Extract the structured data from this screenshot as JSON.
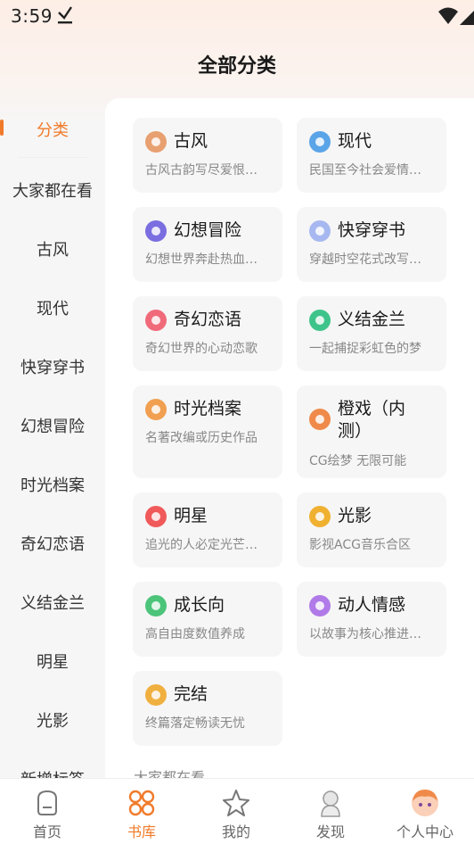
{
  "status_bar": {
    "time": "3:59"
  },
  "header": {
    "title": "全部分类"
  },
  "sidebar": {
    "items": [
      {
        "label": "分类",
        "active": true
      },
      {
        "label": "大家都在看"
      },
      {
        "label": "古风"
      },
      {
        "label": "现代"
      },
      {
        "label": "快穿穿书"
      },
      {
        "label": "幻想冒险"
      },
      {
        "label": "时光档案"
      },
      {
        "label": "奇幻恋语"
      },
      {
        "label": "义结金兰"
      },
      {
        "label": "明星"
      },
      {
        "label": "光影"
      },
      {
        "label": "新增标签"
      }
    ]
  },
  "categories": [
    {
      "title": "古风",
      "desc": "古风古韵写尽爱恨…",
      "color": "#e8a070",
      "icon": "fan-icon"
    },
    {
      "title": "现代",
      "desc": "民国至今社会爱情…",
      "color": "#5aa4e8",
      "icon": "city-icon"
    },
    {
      "title": "幻想冒险",
      "desc": "幻想世界奔赴热血…",
      "color": "#7a6ee0",
      "icon": "planet-icon"
    },
    {
      "title": "快穿穿书",
      "desc": "穿越时空花式改写…",
      "color": "#a7b8f0",
      "icon": "book-icon"
    },
    {
      "title": "奇幻恋语",
      "desc": "奇幻世界的心动恋歌",
      "color": "#f06a7a",
      "icon": "heart-icon"
    },
    {
      "title": "义结金兰",
      "desc": "一起捕捉彩虹色的梦",
      "color": "#3ec48a",
      "icon": "friendship-icon"
    },
    {
      "title": "时光档案",
      "desc": "名著改编或历史作品",
      "color": "#f0a050",
      "icon": "hourglass-icon"
    },
    {
      "title": "橙戏（内测）",
      "desc": "CG绘梦 无限可能",
      "color": "#f08a4a",
      "icon": "theater-icon"
    },
    {
      "title": "明星",
      "desc": "追光的人必定光芒…",
      "color": "#f05a5a",
      "icon": "star-person-icon"
    },
    {
      "title": "光影",
      "desc": "影视ACG音乐合区",
      "color": "#f0b030",
      "icon": "film-icon"
    },
    {
      "title": "成长向",
      "desc": "高自由度数值养成",
      "color": "#4cc47a",
      "icon": "sprout-icon"
    },
    {
      "title": "动人情感",
      "desc": "以故事为核心推进…",
      "color": "#b07ae8",
      "icon": "emotion-icon"
    },
    {
      "title": "完结",
      "desc": "终篇落定畅读无忧",
      "color": "#f0b040",
      "icon": "stack-icon"
    }
  ],
  "section_label": "大家都在看",
  "bottom_nav": [
    {
      "label": "首页",
      "icon": "home-icon"
    },
    {
      "label": "书库",
      "icon": "library-icon",
      "active": true
    },
    {
      "label": "我的",
      "icon": "star-icon"
    },
    {
      "label": "发现",
      "icon": "discover-icon"
    },
    {
      "label": "个人中心",
      "icon": "avatar-icon"
    }
  ],
  "colors": {
    "accent": "#f07b2a"
  }
}
